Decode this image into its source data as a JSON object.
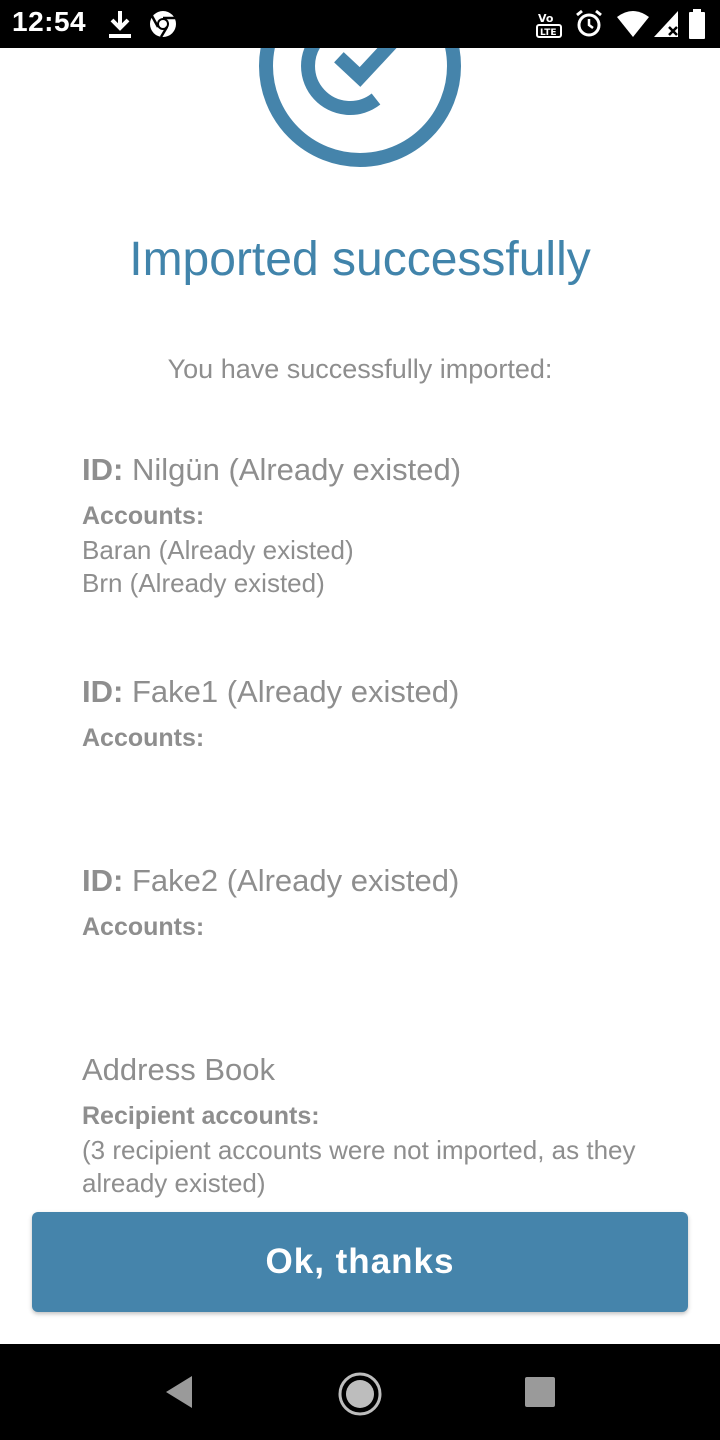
{
  "status_bar": {
    "time": "12:54",
    "icons": [
      "download-icon",
      "chrome-icon",
      "volte-icon",
      "alarm-icon",
      "wifi-icon",
      "cellular-icon",
      "battery-icon"
    ]
  },
  "header": {
    "icon": "check-circle-icon",
    "title": "Imported successfully",
    "subtitle": "You have successfully imported:"
  },
  "identities": [
    {
      "id_prefix": "ID:",
      "id_value": " Nilgün (Already existed)",
      "accounts_label": "Accounts:",
      "accounts": [
        "Baran (Already existed)",
        "Brn (Already existed)"
      ]
    },
    {
      "id_prefix": "ID:",
      "id_value": " Fake1 (Already existed)",
      "accounts_label": "Accounts:",
      "accounts": []
    },
    {
      "id_prefix": "ID:",
      "id_value": " Fake2 (Already existed)",
      "accounts_label": "Accounts:",
      "accounts": []
    }
  ],
  "address_book": {
    "title": "Address Book",
    "label": "Recipient accounts:",
    "note": "(3 recipient accounts were not imported, as they already existed)"
  },
  "button": {
    "label": "Ok, thanks"
  },
  "nav": {
    "buttons": [
      "back-icon",
      "home-icon",
      "recents-icon"
    ]
  },
  "colors": {
    "accent": "#4184ab",
    "button": "#4584ab",
    "text": "#8e8e8e"
  }
}
